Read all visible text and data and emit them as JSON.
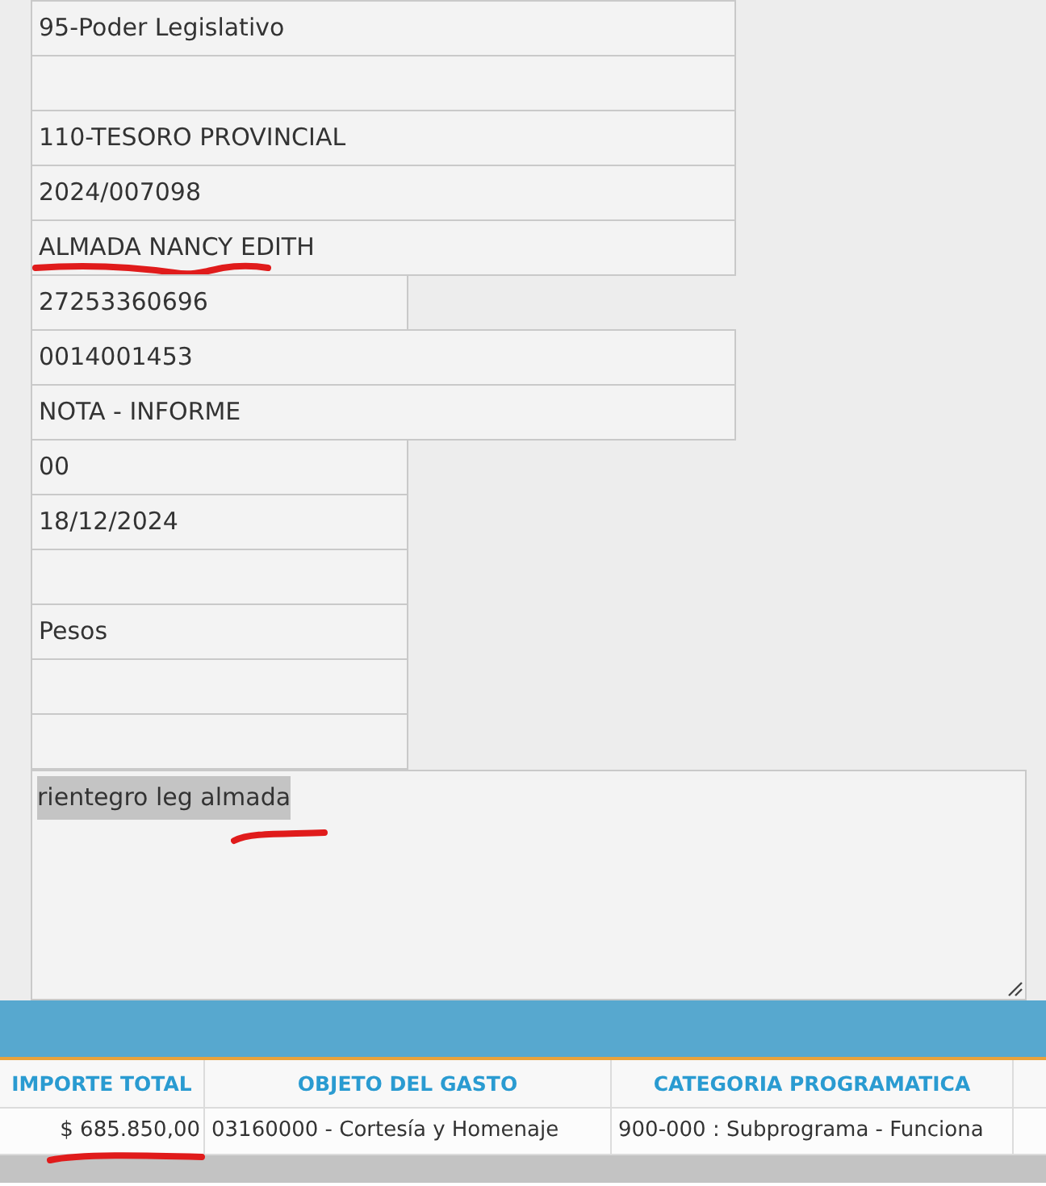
{
  "form": {
    "fields": [
      {
        "kind": "long",
        "value": "95-Poder Legislativo"
      },
      {
        "kind": "long"
      },
      {
        "kind": "long",
        "value": "110-TESORO PROVINCIAL"
      },
      {
        "kind": "long",
        "value": "2024/007098"
      },
      {
        "kind": "long",
        "value": "ALMADA NANCY EDITH",
        "pen_underline": true
      },
      {
        "kind": "short",
        "value": "27253360696"
      },
      {
        "kind": "long",
        "value": "0014001453"
      },
      {
        "kind": "long",
        "value": "NOTA - INFORME"
      },
      {
        "kind": "short",
        "value": "00"
      },
      {
        "kind": "short",
        "value": "18/12/2024"
      },
      {
        "kind": "short"
      },
      {
        "kind": "short",
        "value": "Pesos"
      },
      {
        "kind": "short"
      },
      {
        "kind": "short"
      }
    ],
    "notes": {
      "value": "rientegro leg almada",
      "text_selected": true,
      "pen_underline": true
    }
  },
  "grid": {
    "columns": [
      {
        "label": "IMPORTE TOTAL",
        "kind": "amount"
      },
      {
        "label": "OBJETO DEL GASTO",
        "kind": "text"
      },
      {
        "label": "CATEGORIA PROGRAMATICA",
        "kind": "text"
      }
    ],
    "rows": [
      {
        "cells": [
          {
            "text": "$ 685.850,00",
            "pen_underline": true
          },
          {
            "text": "03160000 - Cortesía y Homenaje"
          },
          {
            "text": "900-000 : Subprograma - Funciona"
          }
        ]
      }
    ]
  }
}
